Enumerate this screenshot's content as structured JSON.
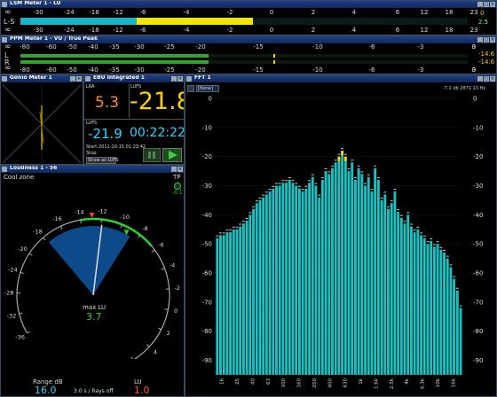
{
  "lsm": {
    "title": "LSM Meter 1 - LU",
    "label_inf": "∞",
    "label_ls": "L-S",
    "ticks": [
      "-30",
      "-24",
      "-18",
      "-12",
      "-6",
      "-4",
      "-2",
      "0",
      "2",
      "4",
      "6",
      "12",
      "18",
      "23"
    ],
    "value_top": "0",
    "value_bottom": "2.5",
    "fill_fraction": 0.52,
    "yellow_start_fraction": 0.26
  },
  "ppm": {
    "title": "PPM Meter 1 - VU / True Peak",
    "label_inf": "∞",
    "label_l": "L",
    "label_r": "R",
    "ticks": [
      "-80",
      "-60",
      "-50",
      "-40",
      "-35",
      "-30",
      "-25",
      "-20",
      "-15",
      "-10",
      "-6",
      "-3",
      "0",
      "3"
    ],
    "value_l": "-14.6",
    "value_r": "-14.6",
    "fill_fraction": 0.42,
    "peak_fraction": 0.565
  },
  "gonio": {
    "title": "Gonio Meter 1"
  },
  "ebu": {
    "title": "EBU Integrated 1",
    "lra_label": "LRA",
    "lra_value": "5.3",
    "lufs_label": "LUFS",
    "lufs_value": "-21.8",
    "lufs2_label": "LUFS",
    "lufs2_value": "-21.9",
    "time_value": "00:22:22",
    "start_label": "Start:",
    "start_value": "2011-10-15 01:23:42",
    "stop_label": "Stop:",
    "show_as_button": "Show as LUFS"
  },
  "loudness": {
    "title": "Loudness 1 - 56",
    "cool_zone": "Cool zone",
    "tp_label": "TP",
    "tp_value": "-0.1",
    "scale": [
      "-36",
      "-32",
      "-28",
      "-24",
      "-20",
      "-18",
      "-16",
      "-14",
      "-12",
      "-10",
      "-8",
      "-6",
      "-4",
      "-2",
      "0",
      "2",
      "4",
      "6",
      "8",
      "10"
    ],
    "max_lu_label": "max LU",
    "max_lu_value": "3.7",
    "range_label": "Range dB",
    "range_value": "16.0",
    "lu_label": "LU",
    "lu_value": "1.0",
    "mode_text": "3.0 s / Rays off"
  },
  "fft": {
    "title": "FFT 1",
    "mode_select": "[None]",
    "readout": "-7.2 db  2871.13 Hz",
    "y_ticks": [
      "0",
      "-10",
      "-20",
      "-30",
      "-40",
      "-50",
      "-60",
      "-70",
      "-80",
      "-90"
    ],
    "x_ticks": [
      "16",
      "25",
      "40",
      "63",
      "100",
      "160",
      "250",
      "400",
      "630",
      "1k",
      "1.6k",
      "2.5k",
      "4k",
      "6.3k",
      "10k",
      "16k"
    ],
    "bar_levels_db": [
      -48,
      -47,
      -47,
      -46,
      -46,
      -45,
      -45,
      -44,
      -43,
      -42,
      -40,
      -38,
      -36,
      -35,
      -34,
      -33,
      -32,
      -31,
      -30,
      -30,
      -29,
      -29,
      -28,
      -29,
      -30,
      -31,
      -32,
      -31,
      -29,
      -27,
      -30,
      -34,
      -28,
      -25,
      -26,
      -24,
      -22,
      -20,
      -18,
      -20,
      -25,
      -22,
      -28,
      -24,
      -26,
      -30,
      -27,
      -32,
      -24,
      -28,
      -35,
      -33,
      -38,
      -36,
      -32,
      -39,
      -41,
      -43,
      -40,
      -44,
      -46,
      -45,
      -47,
      -48,
      -50,
      -49,
      -51,
      -50,
      -52,
      -53,
      -55,
      -58,
      -62,
      -66,
      -72
    ]
  }
}
